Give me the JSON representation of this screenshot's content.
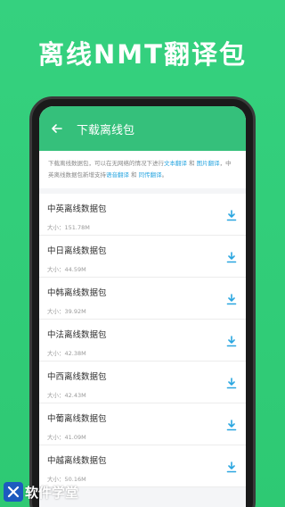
{
  "promo": {
    "title": "离线NMT翻译包"
  },
  "header": {
    "title": "下载离线包"
  },
  "notice": {
    "text_1": "下载离线数据包，可以在无网络的情况下进行",
    "link_text_translate": "文本翻译",
    "text_and_1": "和",
    "link_image_translate": "图片翻译",
    "text_2": "，中英离线数据包新增支持",
    "link_voice_translate": "语音翻译",
    "text_and_2": "和",
    "link_simul_translate": "同传翻译",
    "text_end": "。"
  },
  "size_prefix": "大小：",
  "packages": [
    {
      "name": "中英离线数据包",
      "size": "151.78M"
    },
    {
      "name": "中日离线数据包",
      "size": "44.59M"
    },
    {
      "name": "中韩离线数据包",
      "size": "39.92M"
    },
    {
      "name": "中法离线数据包",
      "size": "42.38M"
    },
    {
      "name": "中西离线数据包",
      "size": "42.43M"
    },
    {
      "name": "中葡离线数据包",
      "size": "41.09M"
    },
    {
      "name": "中越离线数据包",
      "size": "50.16M"
    }
  ],
  "watermark": {
    "text": "软件学堂"
  },
  "colors": {
    "background": "#35d17f",
    "header": "#35c07b",
    "link": "#2aa6e0",
    "download_icon": "#2aa6e0"
  },
  "icons": {
    "back": "arrow-left-icon",
    "download": "download-icon"
  }
}
